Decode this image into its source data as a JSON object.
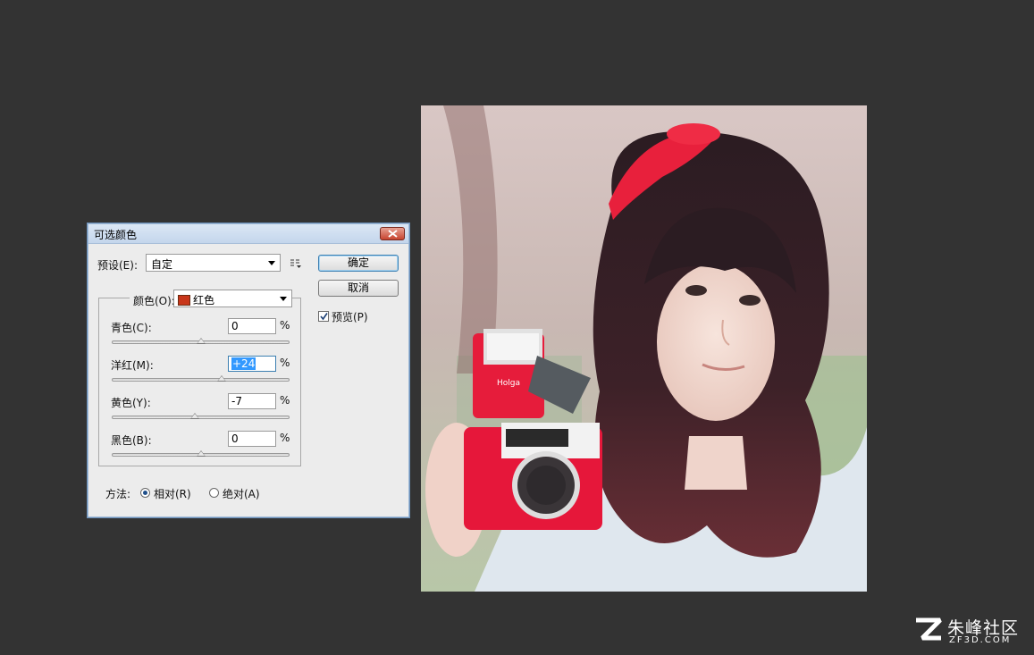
{
  "dialog": {
    "title": "可选颜色",
    "preset_label": "预设(E):",
    "preset_value": "自定",
    "ok_label": "确定",
    "cancel_label": "取消",
    "preview_label": "预览(P)",
    "preview_checked": true,
    "colors_label": "颜色(O):",
    "colors_value": "红色",
    "colors_swatch": "#c8361a",
    "sliders": [
      {
        "label": "青色(C):",
        "value": "0",
        "unit": "%",
        "level": 0.5
      },
      {
        "label": "洋红(M):",
        "value": "+24",
        "unit": "%",
        "level": 0.62
      },
      {
        "label": "黄色(Y):",
        "value": "-7",
        "unit": "%",
        "level": 0.465
      },
      {
        "label": "黑色(B):",
        "value": "0",
        "unit": "%",
        "level": 0.5
      }
    ],
    "method_label": "方法:",
    "method_options": [
      "相对(R)",
      "绝对(A)"
    ],
    "method_selected": "相对(R)"
  },
  "photo": {
    "description_icon": "photo-image",
    "camera_brand": "Holga"
  },
  "watermark": {
    "logo": "zf3d-logo",
    "name": "朱峰社区",
    "url": "ZF3D.COM"
  }
}
